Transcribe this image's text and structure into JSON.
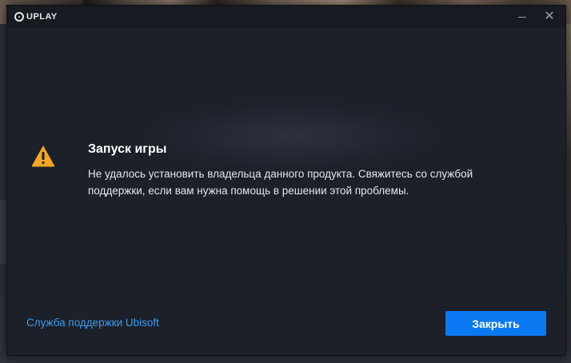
{
  "app": {
    "logo_text": "UPLAY"
  },
  "window_controls": {
    "minimize_icon": "minimize-icon",
    "close_icon": "close-icon",
    "close_glyph": "✕"
  },
  "dialog": {
    "icon": "warning-icon",
    "title": "Запуск игры",
    "message": "Не удалось установить владельца данного продукта. Свяжитесь со службой поддержки, если вам нужна помощь в решении этой проблемы.",
    "support_link": "Служба поддержки Ubisoft",
    "close_button": "Закрыть"
  },
  "colors": {
    "dialog_bg": "#1c2029",
    "titlebar_bg": "#171a21",
    "warning": "#f5a623",
    "link": "#3d9bf0",
    "button": "#0a78f0"
  }
}
